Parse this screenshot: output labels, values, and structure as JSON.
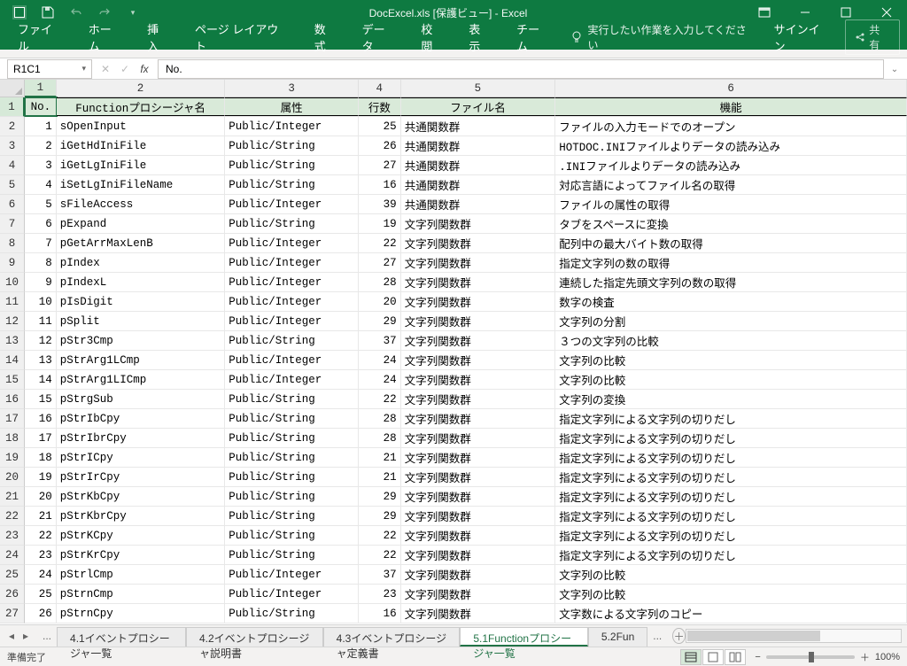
{
  "titlebar": {
    "title": "DocExcel.xls  [保護ビュー] - Excel"
  },
  "ribbon": {
    "tabs": [
      "ファイル",
      "ホーム",
      "挿入",
      "ページ レイアウト",
      "数式",
      "データ",
      "校閲",
      "表示",
      "チーム"
    ],
    "tell_placeholder": "実行したい作業を入力してください",
    "signin": "サインイン",
    "share": "共有"
  },
  "namebox": "R1C1",
  "formula": "No.",
  "colheads": [
    "1",
    "2",
    "3",
    "4",
    "5",
    "6"
  ],
  "rowheads": [
    "1",
    "2",
    "3",
    "4",
    "5",
    "6",
    "7",
    "8",
    "9",
    "10",
    "11",
    "12",
    "13",
    "14",
    "15",
    "16",
    "17",
    "18",
    "19",
    "20",
    "21",
    "22",
    "23",
    "24",
    "25",
    "26",
    "27"
  ],
  "headers": [
    "No.",
    "Functionプロシージャ名",
    "属性",
    "行数",
    "ファイル名",
    "機能"
  ],
  "rows": [
    {
      "no": 1,
      "name": "sOpenInput",
      "attr": "Public/Integer",
      "lines": 25,
      "file": "共通関数群",
      "desc": "ファイルの入力モードでのオープン"
    },
    {
      "no": 2,
      "name": "iGetHdIniFile",
      "attr": "Public/String",
      "lines": 26,
      "file": "共通関数群",
      "desc": "HOTDOC.INIファイルよりデータの読み込み"
    },
    {
      "no": 3,
      "name": "iGetLgIniFile",
      "attr": "Public/String",
      "lines": 27,
      "file": "共通関数群",
      "desc": ".INIファイルよりデータの読み込み"
    },
    {
      "no": 4,
      "name": "iSetLgIniFileName",
      "attr": "Public/String",
      "lines": 16,
      "file": "共通関数群",
      "desc": "対応言語によってファイル名の取得"
    },
    {
      "no": 5,
      "name": "sFileAccess",
      "attr": "Public/Integer",
      "lines": 39,
      "file": "共通関数群",
      "desc": "ファイルの属性の取得"
    },
    {
      "no": 6,
      "name": "pExpand",
      "attr": "Public/String",
      "lines": 19,
      "file": "文字列関数群",
      "desc": "タブをスペースに変換"
    },
    {
      "no": 7,
      "name": "pGetArrMaxLenB",
      "attr": "Public/Integer",
      "lines": 22,
      "file": "文字列関数群",
      "desc": "配列中の最大バイト数の取得"
    },
    {
      "no": 8,
      "name": "pIndex",
      "attr": "Public/Integer",
      "lines": 27,
      "file": "文字列関数群",
      "desc": "指定文字列の数の取得"
    },
    {
      "no": 9,
      "name": "pIndexL",
      "attr": "Public/Integer",
      "lines": 28,
      "file": "文字列関数群",
      "desc": "連続した指定先頭文字列の数の取得"
    },
    {
      "no": 10,
      "name": "pIsDigit",
      "attr": "Public/Integer",
      "lines": 20,
      "file": "文字列関数群",
      "desc": "数字の検査"
    },
    {
      "no": 11,
      "name": "pSplit",
      "attr": "Public/Integer",
      "lines": 29,
      "file": "文字列関数群",
      "desc": "文字列の分割"
    },
    {
      "no": 12,
      "name": "pStr3Cmp",
      "attr": "Public/String",
      "lines": 37,
      "file": "文字列関数群",
      "desc": "３つの文字列の比較"
    },
    {
      "no": 13,
      "name": "pStrArg1LCmp",
      "attr": "Public/Integer",
      "lines": 24,
      "file": "文字列関数群",
      "desc": "文字列の比較"
    },
    {
      "no": 14,
      "name": "pStrArg1LICmp",
      "attr": "Public/Integer",
      "lines": 24,
      "file": "文字列関数群",
      "desc": "文字列の比較"
    },
    {
      "no": 15,
      "name": "pStrgSub",
      "attr": "Public/String",
      "lines": 22,
      "file": "文字列関数群",
      "desc": "文字列の変換"
    },
    {
      "no": 16,
      "name": "pStrIbCpy",
      "attr": "Public/String",
      "lines": 28,
      "file": "文字列関数群",
      "desc": "指定文字列による文字列の切りだし"
    },
    {
      "no": 17,
      "name": "pStrIbrCpy",
      "attr": "Public/String",
      "lines": 28,
      "file": "文字列関数群",
      "desc": "指定文字列による文字列の切りだし"
    },
    {
      "no": 18,
      "name": "pStrICpy",
      "attr": "Public/String",
      "lines": 21,
      "file": "文字列関数群",
      "desc": "指定文字列による文字列の切りだし"
    },
    {
      "no": 19,
      "name": "pStrIrCpy",
      "attr": "Public/String",
      "lines": 21,
      "file": "文字列関数群",
      "desc": "指定文字列による文字列の切りだし"
    },
    {
      "no": 20,
      "name": "pStrKbCpy",
      "attr": "Public/String",
      "lines": 29,
      "file": "文字列関数群",
      "desc": "指定文字列による文字列の切りだし"
    },
    {
      "no": 21,
      "name": "pStrKbrCpy",
      "attr": "Public/String",
      "lines": 29,
      "file": "文字列関数群",
      "desc": "指定文字列による文字列の切りだし"
    },
    {
      "no": 22,
      "name": "pStrKCpy",
      "attr": "Public/String",
      "lines": 22,
      "file": "文字列関数群",
      "desc": "指定文字列による文字列の切りだし"
    },
    {
      "no": 23,
      "name": "pStrKrCpy",
      "attr": "Public/String",
      "lines": 22,
      "file": "文字列関数群",
      "desc": "指定文字列による文字列の切りだし"
    },
    {
      "no": 24,
      "name": "pStrlCmp",
      "attr": "Public/Integer",
      "lines": 37,
      "file": "文字列関数群",
      "desc": "文字列の比較"
    },
    {
      "no": 25,
      "name": "pStrnCmp",
      "attr": "Public/Integer",
      "lines": 23,
      "file": "文字列関数群",
      "desc": "文字列の比較"
    },
    {
      "no": 26,
      "name": "pStrnCpy",
      "attr": "Public/String",
      "lines": 16,
      "file": "文字列関数群",
      "desc": "文字数による文字列のコピー"
    }
  ],
  "sheet_tabs": {
    "prefix": "...",
    "items": [
      "4.1イベントプロシージャ一覧",
      "4.2イベントプロシージャ説明書",
      "4.3イベントプロシージャ定義書",
      "5.1Functionプロシージャ一覧",
      "5.2Fun"
    ],
    "active_index": 3,
    "suffix": "..."
  },
  "status": {
    "ready": "準備完了",
    "zoom": "100%"
  }
}
